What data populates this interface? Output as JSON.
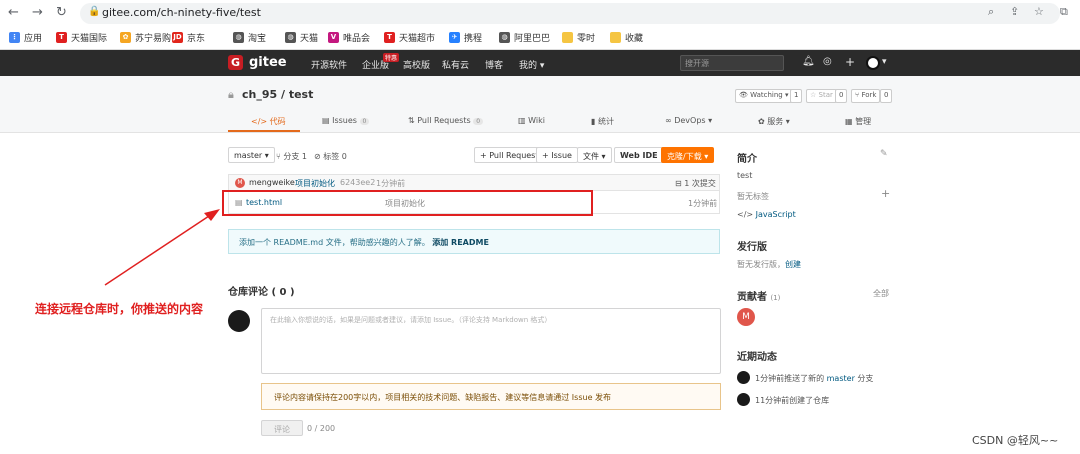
{
  "browser": {
    "url": "gitee.com/ch-ninety-five/test",
    "bookmarks": [
      {
        "label": "应用",
        "icon": "apps-icon",
        "color": "#4285f4"
      },
      {
        "label": "天猫国际",
        "icon": "tmall-icon",
        "color": "#e02020"
      },
      {
        "label": "苏宁易购",
        "icon": "suning-icon",
        "color": "#f5a623"
      },
      {
        "label": "京东",
        "icon": "jd-icon",
        "color": "#e1251b"
      },
      {
        "label": "淘宝",
        "icon": "globe-icon",
        "color": "#555555"
      },
      {
        "label": "天猫",
        "icon": "globe-icon",
        "color": "#555555"
      },
      {
        "label": "唯品会",
        "icon": "vip-icon",
        "color": "#c4187f"
      },
      {
        "label": "天猫超市",
        "icon": "tmall-icon",
        "color": "#e02020"
      },
      {
        "label": "携程",
        "icon": "ctrip-icon",
        "color": "#2681ff"
      },
      {
        "label": "阿里巴巴",
        "icon": "globe-icon",
        "color": "#555555"
      },
      {
        "label": "零时",
        "icon": "folder-icon",
        "color": "#f5c542"
      },
      {
        "label": "收藏",
        "icon": "folder-icon",
        "color": "#f5c542"
      }
    ]
  },
  "topnav": {
    "logo": "gitee",
    "links": [
      "开源软件",
      "企业版",
      "高校版",
      "私有云",
      "博客",
      "我的"
    ],
    "hot_badge": "特惠",
    "search_placeholder": "搜开源"
  },
  "repo": {
    "title": "ch_95 / test",
    "watching": "Watching",
    "watching_count": "1",
    "star": "Star",
    "star_count": "0",
    "fork": "Fork",
    "fork_count": "0",
    "tabs": [
      {
        "label": "代码",
        "icon": "code-icon"
      },
      {
        "label": "Issues",
        "badge": "0",
        "icon": "issue-icon"
      },
      {
        "label": "Pull Requests",
        "badge": "0",
        "icon": "pr-icon"
      },
      {
        "label": "Wiki",
        "icon": "wiki-icon"
      },
      {
        "label": "统计",
        "icon": "stats-icon"
      },
      {
        "label": "DevOps",
        "icon": "devops-icon"
      },
      {
        "label": "服务",
        "icon": "service-icon"
      },
      {
        "label": "管理",
        "icon": "manage-icon"
      }
    ]
  },
  "toolbar": {
    "branch": "master",
    "branches": "分支 1",
    "tags": "标签 0",
    "pull_request": "+ Pull Request",
    "issue": "+ Issue",
    "file": "文件",
    "webide": "Web IDE",
    "clone": "克隆/下载"
  },
  "commit": {
    "author": "mengweike",
    "message": "项目初始化",
    "hash": "6243ee2",
    "time": "1分钟前",
    "count": "1 次提交"
  },
  "files": [
    {
      "name": "test.html",
      "message": "项目初始化",
      "time": "1分钟前"
    }
  ],
  "readme_hint": {
    "text": "添加一个 README.md 文件，帮助感兴趣的人了解。",
    "link": "添加 README"
  },
  "comments": {
    "title": "仓库评论 ( 0 )",
    "placeholder": "在此输入你想说的话，如果是问题或者建议，请添加 Issue。（评论支持 Markdown 格式）",
    "warning": "评论内容请保持在200字以内，项目相关的技术问题、缺陷报告、建议等信息请通过 Issue 发布",
    "submit": "评论",
    "counter": "0 / 200"
  },
  "sidebar": {
    "intro_title": "简介",
    "intro_text": "test",
    "no_tags": "暂无标签",
    "language": "JavaScript",
    "releases_title": "发行版",
    "no_release": "暂无发行版，",
    "create": "创建",
    "contributors_title": "贡献者",
    "contributors_count": "(1)",
    "all": "全部",
    "contributor_initial": "M",
    "activity_title": "近期动态",
    "activities": [
      {
        "text": "1分钟前推送了新的",
        "branch": "master",
        "suffix": "分支"
      },
      {
        "text": "11分钟前创建了仓库"
      }
    ]
  },
  "annotation": "连接远程仓库时，你推送的内容",
  "watermark": "CSDN @轻风~~",
  "colors": {
    "brand": "#c71d23",
    "accent": "#fe7300",
    "annotation": "#e02020"
  }
}
